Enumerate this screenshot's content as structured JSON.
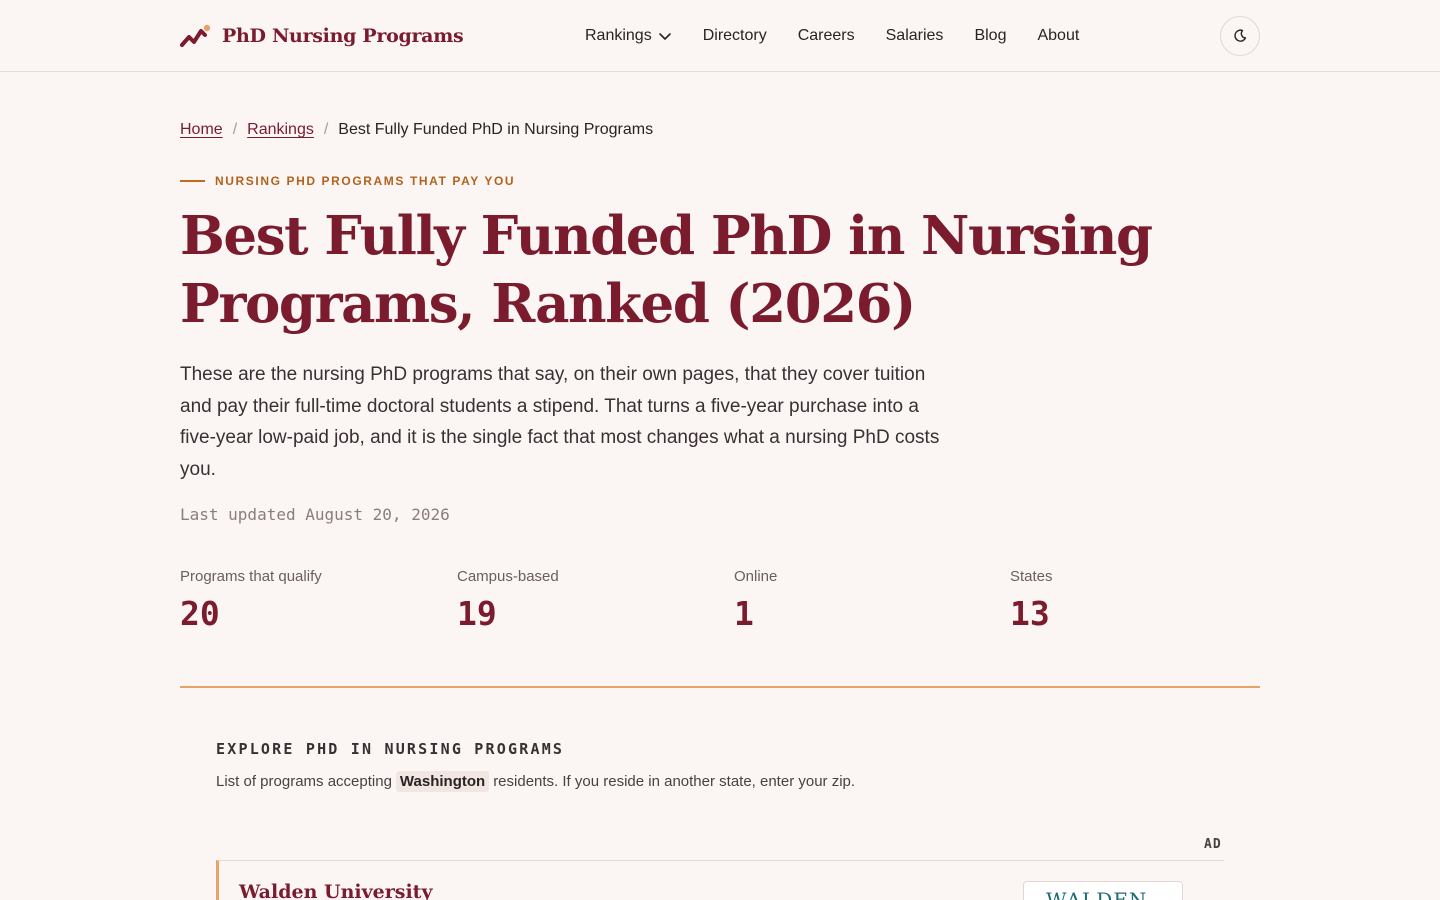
{
  "header": {
    "logo_text": "PhD Nursing Programs",
    "logo_icon": "chart-trend-icon",
    "nav": [
      {
        "label": "Rankings",
        "has_dropdown": true
      },
      {
        "label": "Directory"
      },
      {
        "label": "Careers"
      },
      {
        "label": "Salaries"
      },
      {
        "label": "Blog"
      },
      {
        "label": "About"
      }
    ],
    "theme_toggle_icon": "moon-icon"
  },
  "breadcrumb": {
    "home": "Home",
    "rankings": "Rankings",
    "separator": "/",
    "current": "Best Fully Funded PhD in Nursing Programs"
  },
  "hero": {
    "eyebrow": "NURSING PHD PROGRAMS THAT PAY YOU",
    "title": "Best Fully Funded PhD in Nursing Programs, Ranked (2026)",
    "lede": "These are the nursing PhD programs that say, on their own pages, that they cover tuition and pay their full-time doctoral students a stipend. That turns a five-year purchase into a five-year low-paid job, and it is the single fact that most changes what a nursing PhD costs you.",
    "updated": "Last updated August 20, 2026"
  },
  "stats": [
    {
      "label": "Programs that qualify",
      "value": "20"
    },
    {
      "label": "Campus-based",
      "value": "19"
    },
    {
      "label": "Online",
      "value": "1"
    },
    {
      "label": "States",
      "value": "13"
    }
  ],
  "explore": {
    "heading": "EXPLORE PHD IN NURSING PROGRAMS",
    "sub_before": "List of programs accepting",
    "state": "Washington",
    "sub_after": "residents. If you reside in another state, enter your zip."
  },
  "ad": {
    "label": "AD",
    "school": "Walden University",
    "logo_text": "WALDEN"
  },
  "colors": {
    "background": "#fbf6f4",
    "brand": "#7a1b2e",
    "accent": "#e8a36b",
    "eyebrow": "#b3621e"
  }
}
